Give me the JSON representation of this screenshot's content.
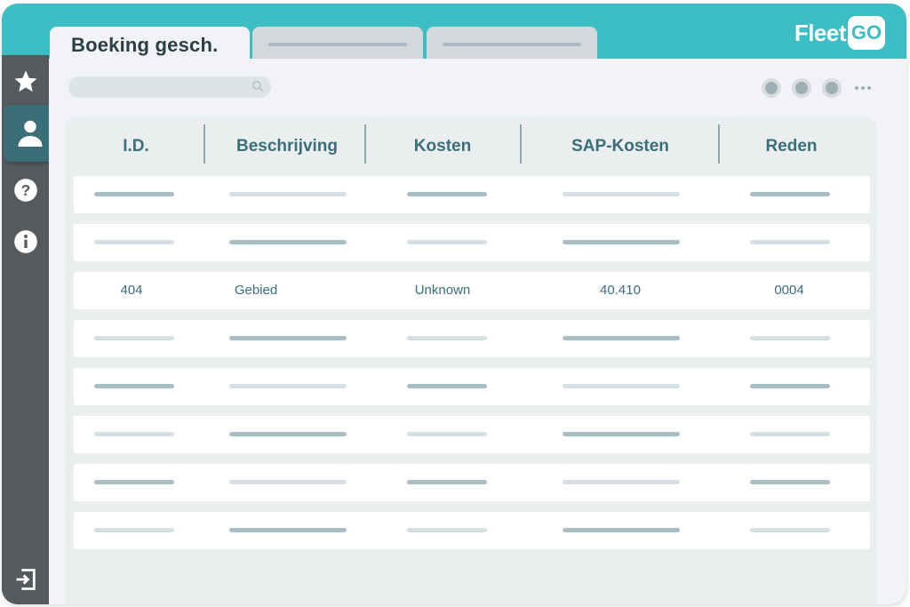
{
  "brand": {
    "name": "Fleet",
    "suffix": "GO",
    "accent": "#3dbdc4",
    "dark": "#555a5e",
    "teal": "#3b6e78"
  },
  "tabs": [
    {
      "label": "Boeking gesch."
    }
  ],
  "sidebar": {
    "items": [
      "star-icon",
      "user-icon",
      "help-icon",
      "info-icon",
      "logout-icon"
    ]
  },
  "table": {
    "columns": [
      "I.D.",
      "Beschrijving",
      "Kosten",
      "SAP-Kosten",
      "Reden"
    ],
    "highlight_row": {
      "id": "404",
      "beschrijving": "Gebied",
      "kosten": "Unknown",
      "sap_kosten": "40.410",
      "reden": "0004"
    }
  }
}
